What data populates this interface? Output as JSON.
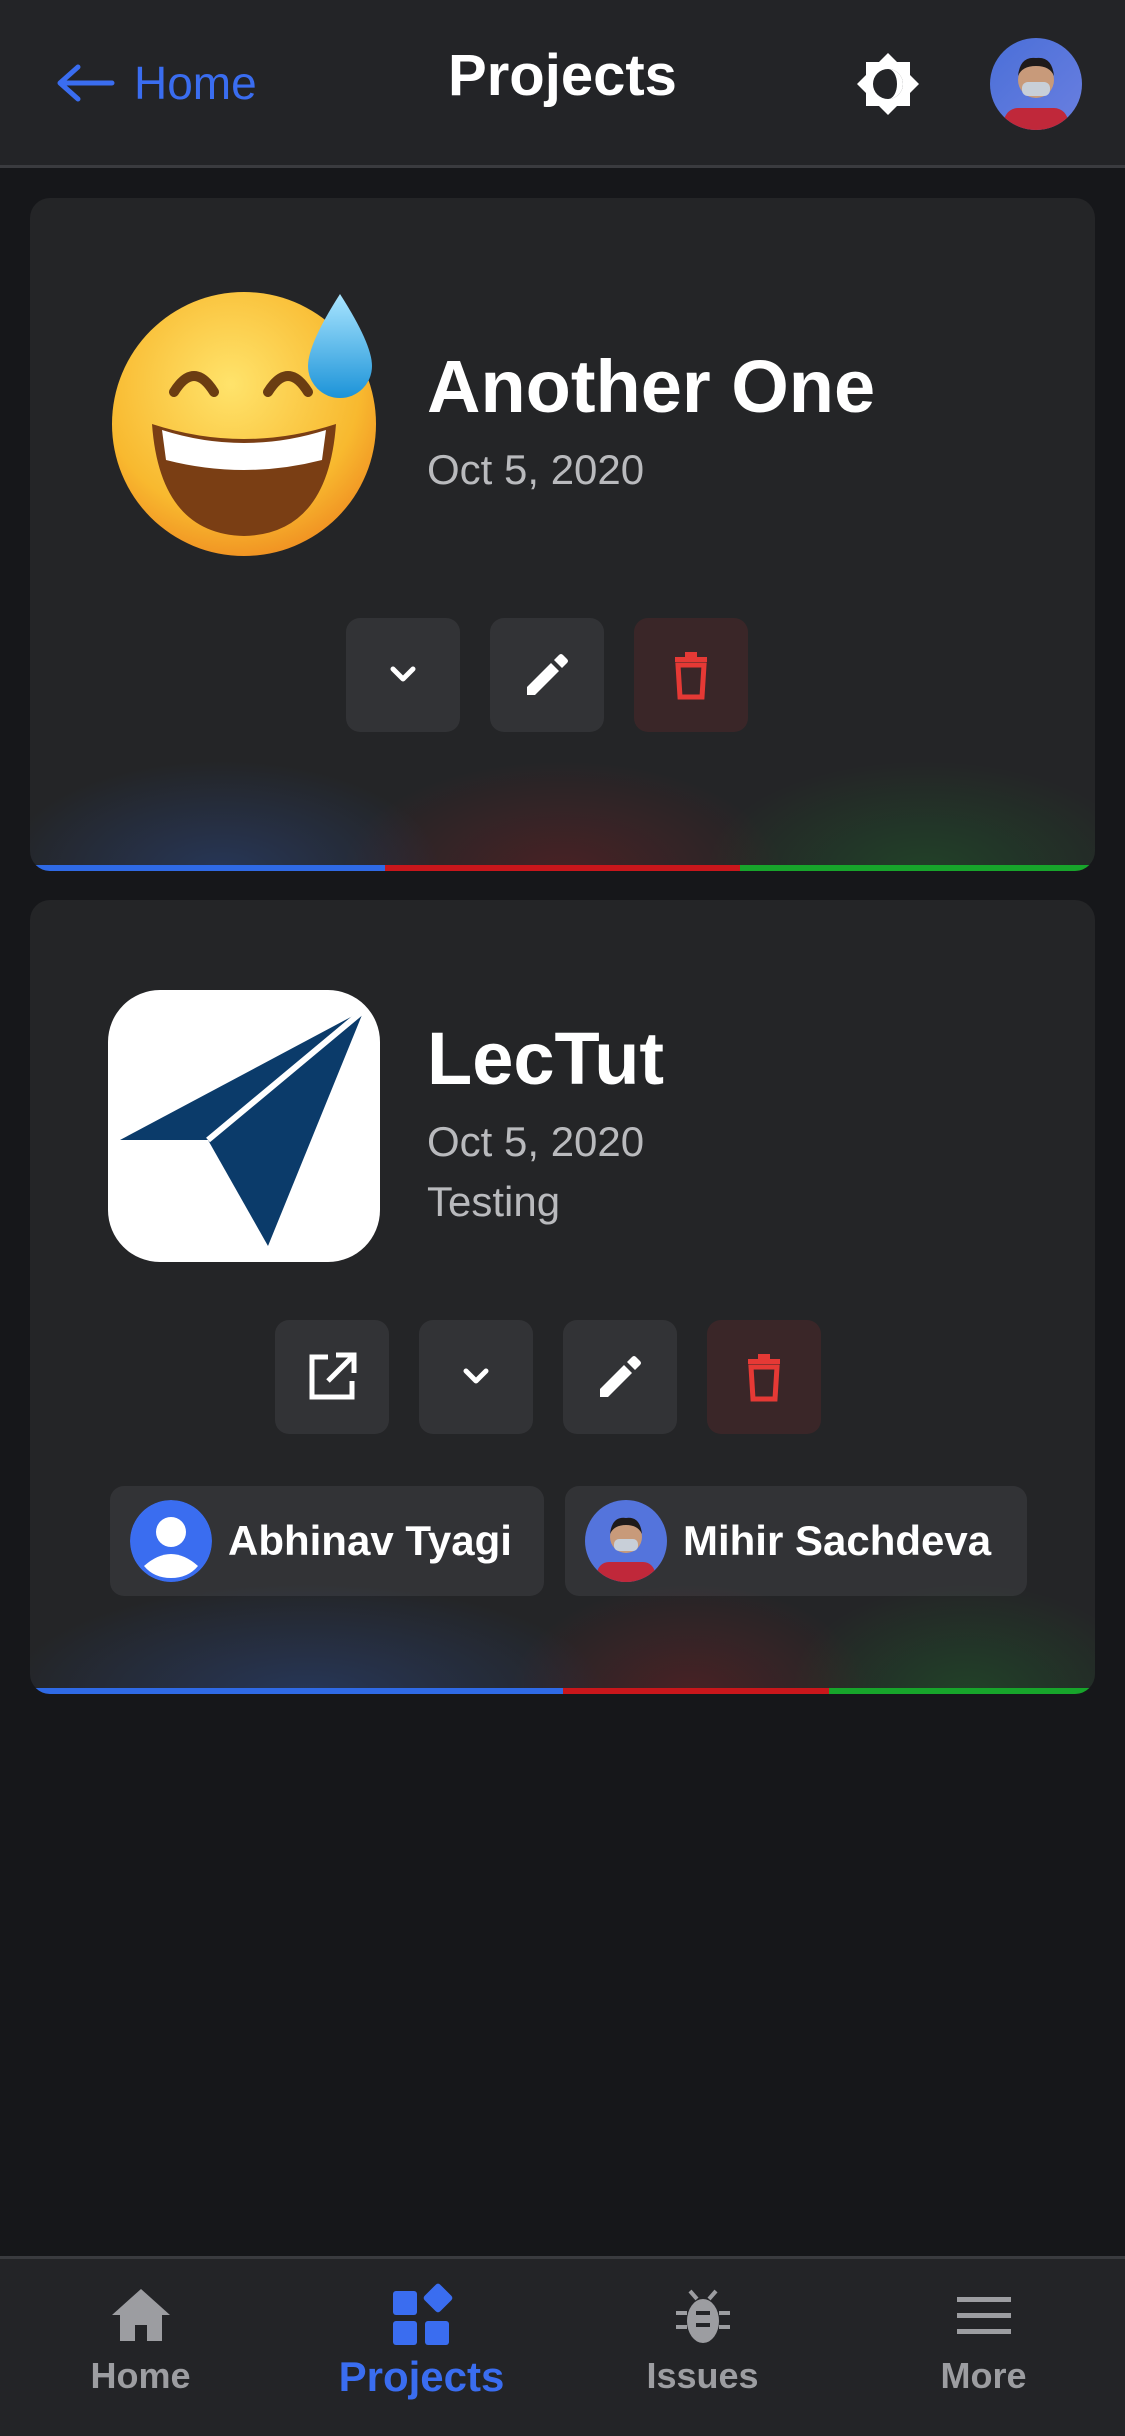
{
  "header": {
    "back_label": "Home",
    "title": "Projects",
    "theme_icon": "brightness-icon",
    "avatar_icon": "user-avatar"
  },
  "projects": [
    {
      "name": "Another One",
      "date": "Oct 5, 2020",
      "icon": "sweat-smile-emoji",
      "actions": [
        "expand",
        "edit",
        "delete"
      ]
    },
    {
      "name": "LecTut",
      "date": "Oct 5, 2020",
      "description": "Testing",
      "icon": "paper-plane-logo",
      "actions": [
        "open-external",
        "expand",
        "edit",
        "delete"
      ],
      "members": [
        {
          "name": "Abhinav Tyagi",
          "avatar": "default-person-avatar"
        },
        {
          "name": "Mihir Sachdeva",
          "avatar": "photo-avatar"
        }
      ]
    }
  ],
  "bottom_nav": {
    "items": [
      {
        "label": "Home",
        "icon": "home-icon"
      },
      {
        "label": "Projects",
        "icon": "projects-icon",
        "active": true
      },
      {
        "label": "Issues",
        "icon": "bug-icon"
      },
      {
        "label": "More",
        "icon": "menu-icon"
      }
    ]
  },
  "colors": {
    "accent": "#3a6df0",
    "danger": "#e53935",
    "strip_blue": "#2f6ae6",
    "strip_red": "#c9161b",
    "strip_green": "#17a52b",
    "background": "#16171a",
    "surface": "#242527"
  }
}
